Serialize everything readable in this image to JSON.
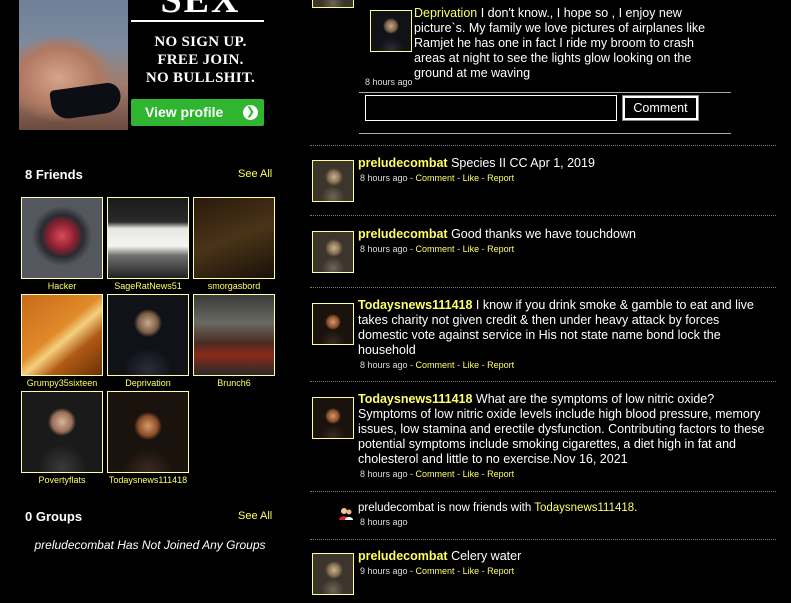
{
  "ad": {
    "headline": "SEX",
    "line1": "NO SIGN UP.",
    "line2": "FREE JOIN.",
    "line3": "NO BULLSHIT.",
    "button_label": "View profile",
    "button_color": "#2fb52f"
  },
  "friends": {
    "title": "8 Friends",
    "see_all": "See All",
    "items": [
      {
        "name": "Hacker"
      },
      {
        "name": "SageRatNews51"
      },
      {
        "name": "smorgasbord"
      },
      {
        "name": "Grumpy35sixteen"
      },
      {
        "name": "Deprivation"
      },
      {
        "name": "Brunch6"
      },
      {
        "name": "Povertyflats"
      },
      {
        "name": "Todaysnews111418"
      }
    ]
  },
  "groups": {
    "title": "0 Groups",
    "see_all": "See All",
    "empty_text": "preludecombat Has Not Joined Any Groups"
  },
  "feed": {
    "comment": {
      "author": "Deprivation",
      "text": " I don't know., I hope so , I enjoy new picture`s. My family we love pictures of airplanes like Ramjet he has one in fact I ride my broom to crash areas at night to see the lights glow looking on the ground at me waving",
      "time": "8 hours ago"
    },
    "comment_input": {
      "value": "",
      "button_label": "Comment"
    },
    "posts": [
      {
        "author": "preludecombat",
        "text": " Species II CC Apr 1, 2019",
        "time": "8 hours ago"
      },
      {
        "author": "preludecombat",
        "text": " Good thanks we have touchdown",
        "time": "8 hours ago"
      },
      {
        "author": "Todaysnews111418",
        "text": " I know if you drink smoke & gamble to eat and live takes charity not given credit & then under heavy attack by forces domestic vote against service in His not state name bond lock the household",
        "time": "8 hours ago"
      },
      {
        "author": "Todaysnews111418",
        "text": " What are the symptoms of low nitric oxide? Symptoms of low nitric oxide levels include high blood pressure, memory issues, low stamina and erectile dysfunction. Contributing factors to these potential symptoms include smoking cigarettes, a diet high in fat and cholesterol and little to no exercise.Nov 16, 2021",
        "time": "8 hours ago"
      },
      {
        "author": "preludecombat",
        "text": " Celery water",
        "time": "9 hours ago"
      }
    ],
    "activity": {
      "prefix": "preludecombat is now friends with ",
      "friend": "Todaysnews111418",
      "suffix": ".",
      "time": "8 hours ago"
    },
    "actions": {
      "sep": " - ",
      "comment": "Comment",
      "like": "Like",
      "report": "Report"
    }
  },
  "colors": {
    "link": "#ffff66",
    "background": "#000000"
  }
}
